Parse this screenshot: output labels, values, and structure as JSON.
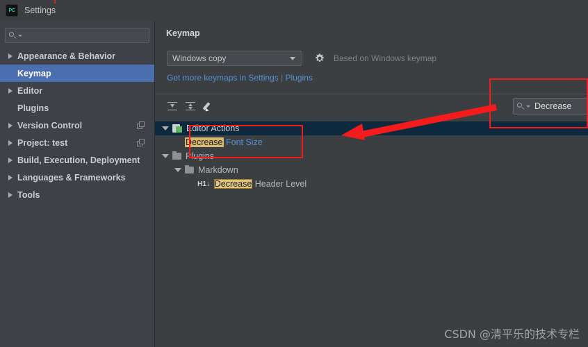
{
  "window": {
    "title": "Settings",
    "app_icon": "pycharm-icon",
    "app_icon_text": "PC"
  },
  "sidebar": {
    "search": {
      "value": "",
      "placeholder": "",
      "icon": "search-icon"
    },
    "items": [
      {
        "label": "Appearance & Behavior",
        "expandable": true,
        "selected": false,
        "copy_icon": false
      },
      {
        "label": "Keymap",
        "expandable": false,
        "selected": true,
        "copy_icon": false
      },
      {
        "label": "Editor",
        "expandable": true,
        "selected": false,
        "copy_icon": false
      },
      {
        "label": "Plugins",
        "expandable": false,
        "selected": false,
        "copy_icon": false
      },
      {
        "label": "Version Control",
        "expandable": true,
        "selected": false,
        "copy_icon": true
      },
      {
        "label": "Project: test",
        "expandable": true,
        "selected": false,
        "copy_icon": true
      },
      {
        "label": "Build, Execution, Deployment",
        "expandable": true,
        "selected": false,
        "copy_icon": false
      },
      {
        "label": "Languages & Frameworks",
        "expandable": true,
        "selected": false,
        "copy_icon": false
      },
      {
        "label": "Tools",
        "expandable": true,
        "selected": false,
        "copy_icon": false
      }
    ]
  },
  "main": {
    "title": "Keymap",
    "keymap_select": {
      "value": "Windows copy",
      "icon": "chevron-down-icon"
    },
    "gear_icon": "gear-icon",
    "based_on": "Based on Windows keymap",
    "get_more": {
      "prefix": "Get more keymaps in Settings",
      "separator": " | ",
      "suffix": "Plugins"
    },
    "toolbar": [
      {
        "name": "expand-all-icon",
        "tooltip": "Expand All"
      },
      {
        "name": "collapse-all-icon",
        "tooltip": "Collapse All"
      },
      {
        "name": "edit-shortcut-icon",
        "tooltip": "Edit Shortcut"
      }
    ],
    "filter_search": {
      "value": "Decrease",
      "icon": "search-icon"
    }
  },
  "tree": {
    "rows": [
      {
        "indent": 0,
        "twisty": "down",
        "icon": "editor-actions-icon",
        "selected": true,
        "parts": [
          {
            "text": "Editor Actions",
            "style": "white"
          }
        ]
      },
      {
        "indent": 1,
        "twisty": "none",
        "icon": "none",
        "selected": false,
        "parts": [
          {
            "text": "Decrease",
            "style": "highlight"
          },
          {
            "text": " ",
            "style": "plain"
          },
          {
            "text": "Font Size",
            "style": "link"
          }
        ]
      },
      {
        "indent": 0,
        "twisty": "down",
        "icon": "folder-icon",
        "selected": false,
        "parts": [
          {
            "text": "Plugins",
            "style": "plain"
          }
        ]
      },
      {
        "indent": 1,
        "twisty": "down",
        "icon": "folder-icon",
        "selected": false,
        "parts": [
          {
            "text": "Markdown",
            "style": "plain"
          }
        ]
      },
      {
        "indent": 2,
        "twisty": "none",
        "icon": "h1-down-icon",
        "icon_text": "H1↓",
        "selected": false,
        "parts": [
          {
            "text": "Decrease",
            "style": "highlight-outline"
          },
          {
            "text": " ",
            "style": "plain"
          },
          {
            "text": "Header Level",
            "style": "plain"
          }
        ]
      }
    ]
  },
  "annotations": {
    "color": "#f31b1b",
    "boxes": [
      {
        "name": "search-field-callout"
      },
      {
        "name": "tree-match-callout"
      }
    ],
    "arrow": {
      "name": "pointer-arrow",
      "from": "search-field",
      "to": "tree-row"
    }
  },
  "watermark": {
    "text": "CSDN @清平乐的技术专栏"
  },
  "colors": {
    "window_bg": "#3c3f41",
    "sidebar_bg": "#3f4149",
    "selection_blue": "#4b6eaf",
    "tree_selection": "#0d293e",
    "link": "#5691d4",
    "highlight": "#d6b871",
    "annotation_red": "#f31b1b"
  }
}
